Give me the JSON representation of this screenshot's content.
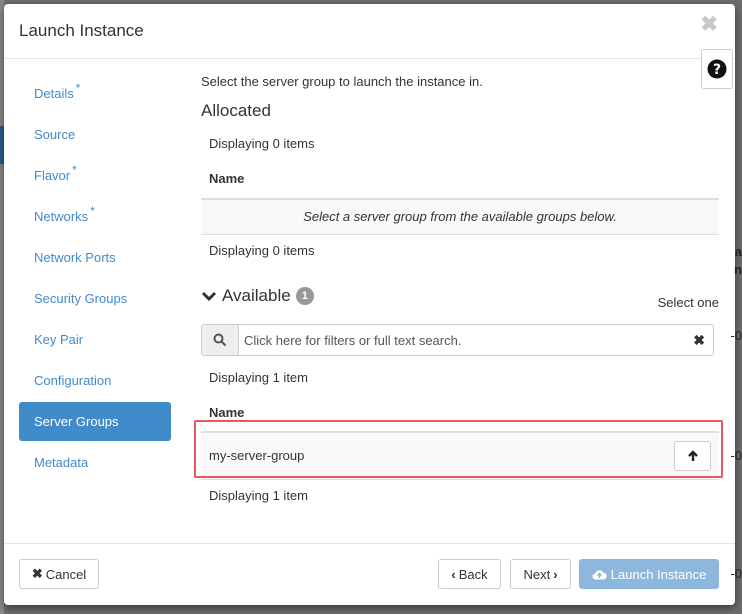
{
  "background": {
    "right_fragments": [
      "a",
      "n",
      "-0",
      "-0",
      "-0"
    ]
  },
  "modal": {
    "title": "Launch Instance",
    "close_glyph": "✖"
  },
  "nav": {
    "items": [
      {
        "label": "Details",
        "required": true,
        "active": false
      },
      {
        "label": "Source",
        "required": false,
        "active": false
      },
      {
        "label": "Flavor",
        "required": true,
        "active": false
      },
      {
        "label": "Networks",
        "required": true,
        "active": false
      },
      {
        "label": "Network Ports",
        "required": false,
        "active": false
      },
      {
        "label": "Security Groups",
        "required": false,
        "active": false
      },
      {
        "label": "Key Pair",
        "required": false,
        "active": false
      },
      {
        "label": "Configuration",
        "required": false,
        "active": false
      },
      {
        "label": "Server Groups",
        "required": false,
        "active": true
      },
      {
        "label": "Metadata",
        "required": false,
        "active": false
      }
    ],
    "required_mark": "*"
  },
  "main": {
    "intro": "Select the server group to launch the instance in.",
    "allocated": {
      "title": "Allocated",
      "count_top": "Displaying 0 items",
      "column_name": "Name",
      "empty_message": "Select a server group from the available groups below.",
      "count_bottom": "Displaying 0 items"
    },
    "available": {
      "title": "Available",
      "badge": "1",
      "select_hint": "Select one",
      "search_placeholder": "Click here for filters or full text search.",
      "count_top": "Displaying 1 item",
      "column_name": "Name",
      "rows": [
        {
          "name": "my-server-group"
        }
      ],
      "count_bottom": "Displaying 1 item"
    }
  },
  "footer": {
    "cancel_label": "Cancel",
    "back_label": "Back",
    "next_label": "Next",
    "launch_label": "Launch Instance"
  },
  "colors": {
    "accent": "#428bca",
    "launch_disabled": "#8db7dd",
    "highlight": "#e8585f"
  }
}
